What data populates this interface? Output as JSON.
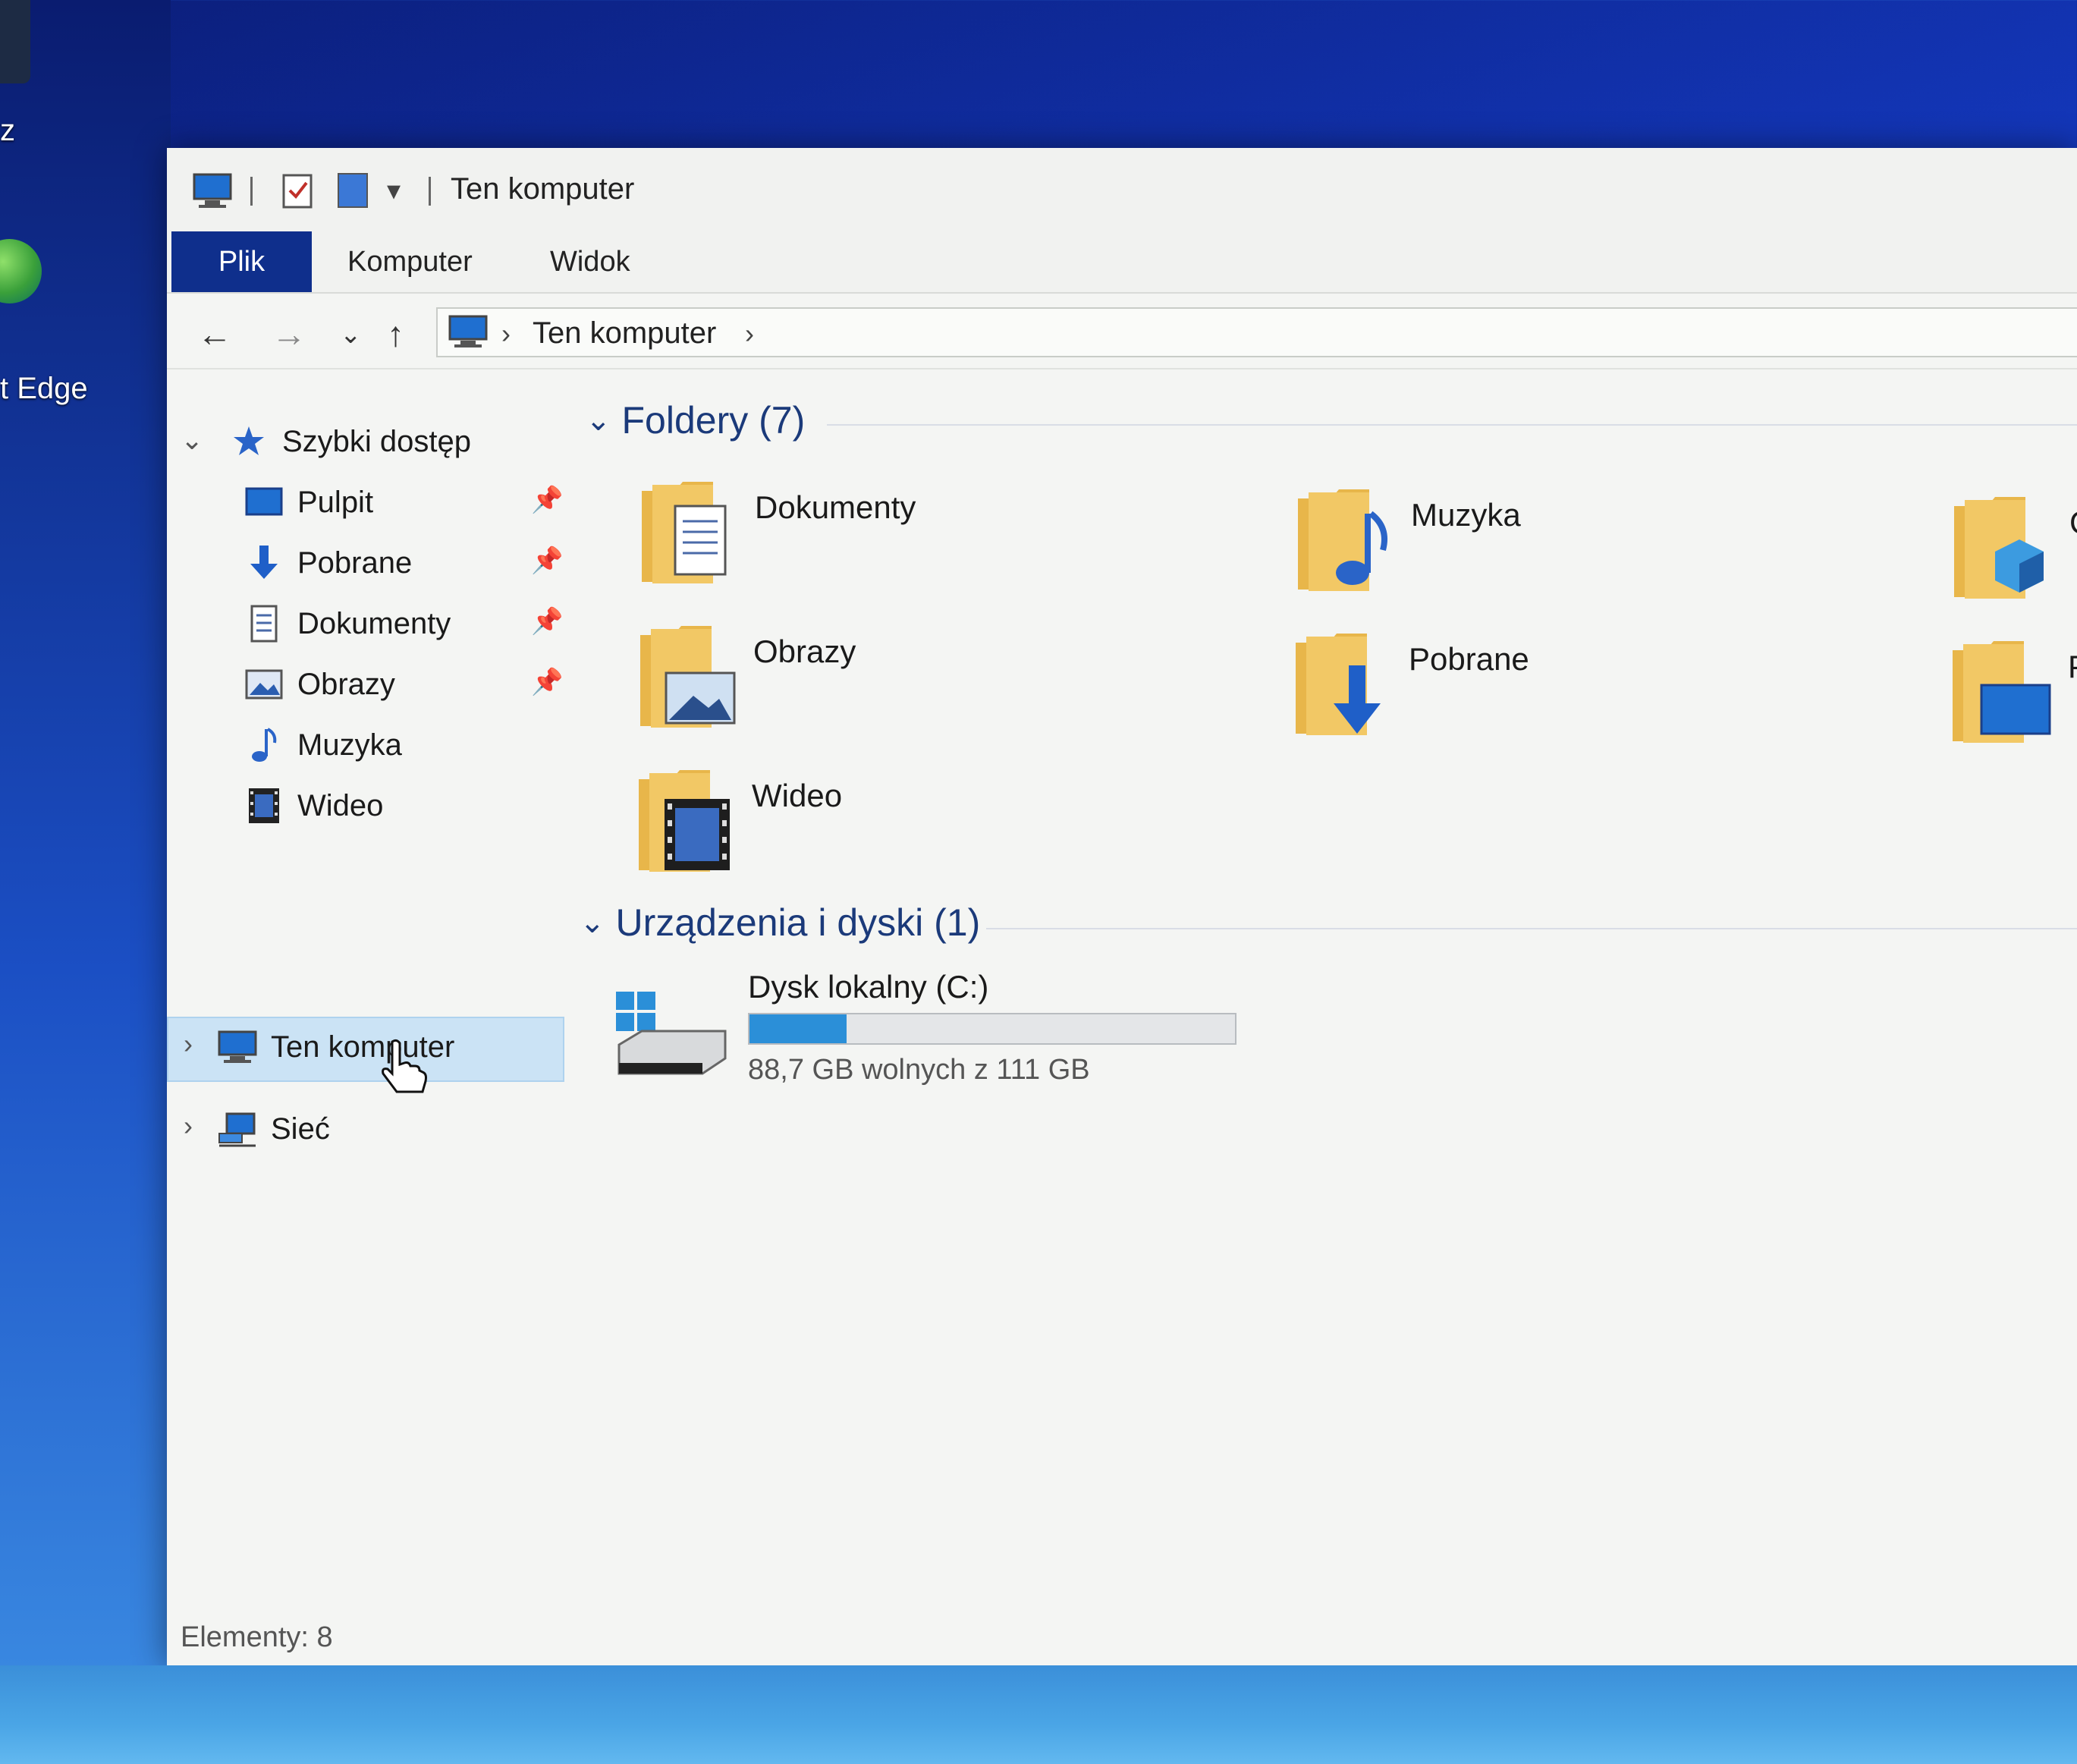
{
  "desktop": {
    "left_label_top": "z",
    "edge_label": "t Edge"
  },
  "window": {
    "title": "Ten komputer",
    "ribbon_tabs": [
      "Plik",
      "Komputer",
      "Widok"
    ],
    "address": {
      "crumb": "Ten komputer",
      "sep": "›"
    },
    "nav": {
      "back": "←",
      "forward": "→",
      "recent": "⌄",
      "up": "↑"
    }
  },
  "sidebar": {
    "quick_access": "Szybki dostęp",
    "quick_items": [
      {
        "label": "Pulpit",
        "pinned": true
      },
      {
        "label": "Pobrane",
        "pinned": true
      },
      {
        "label": "Dokumenty",
        "pinned": true
      },
      {
        "label": "Obrazy",
        "pinned": true
      },
      {
        "label": "Muzyka",
        "pinned": false
      },
      {
        "label": "Wideo",
        "pinned": false
      }
    ],
    "this_pc": "Ten komputer",
    "network": "Sieć"
  },
  "content": {
    "folders_header": "Foldery (7)",
    "folders": [
      {
        "label": "Dokumenty",
        "icon": "documents-folder-icon"
      },
      {
        "label": "Muzyka",
        "icon": "music-folder-icon"
      },
      {
        "label": "C",
        "icon": "3d-objects-folder-icon"
      },
      {
        "label": "Obrazy",
        "icon": "pictures-folder-icon"
      },
      {
        "label": "Pobrane",
        "icon": "downloads-folder-icon"
      },
      {
        "label": "P",
        "icon": "desktop-folder-icon"
      },
      {
        "label": "Wideo",
        "icon": "videos-folder-icon"
      }
    ],
    "devices_header": "Urządzenia i dyski (1)",
    "drive": {
      "name": "Dysk lokalny (C:)",
      "free_text": "88,7 GB wolnych z 111 GB",
      "used_fraction": 0.2,
      "bar_color": "#2b8fd8"
    }
  },
  "status": {
    "items": "Elementy: 8"
  },
  "colors": {
    "file_tab": "#0f2f8c",
    "selection": "#cbe3f5",
    "group_header": "#1b3a7a",
    "folder_yellow": "#e8b64a"
  }
}
